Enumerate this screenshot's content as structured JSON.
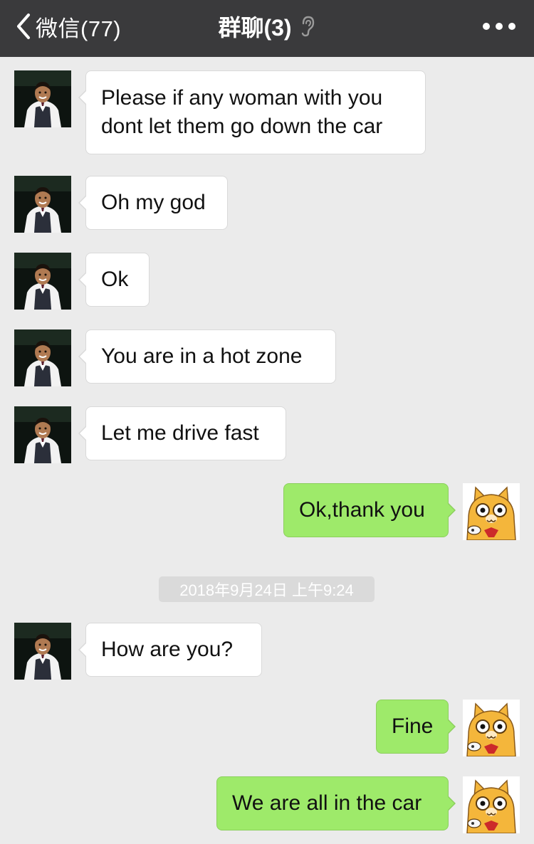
{
  "header": {
    "back_label": "微信(77)",
    "title": "群聊(3)",
    "title_icon": "ear-icon",
    "more_icon": "more-dots-icon"
  },
  "messages": [
    {
      "sender": "contact",
      "text": "Please if any woman with you dont let them go down the car"
    },
    {
      "sender": "contact",
      "text": "Oh my god"
    },
    {
      "sender": "contact",
      "text": "Ok"
    },
    {
      "sender": "contact",
      "text": "You are in a hot zone"
    },
    {
      "sender": "contact",
      "text": "Let me drive fast"
    },
    {
      "sender": "me",
      "text": "Ok,thank you"
    },
    {
      "sender": "contact",
      "text": "How are you?"
    },
    {
      "sender": "me",
      "text": "Fine"
    },
    {
      "sender": "me",
      "text": "We are all in the car"
    }
  ],
  "timestamp": "2018年9月24日 上午9:24",
  "colors": {
    "header_bg": "#3a3a3c",
    "chat_bg": "#ebebeb",
    "incoming_bubble": "#ffffff",
    "outgoing_bubble": "#9eea6a"
  }
}
